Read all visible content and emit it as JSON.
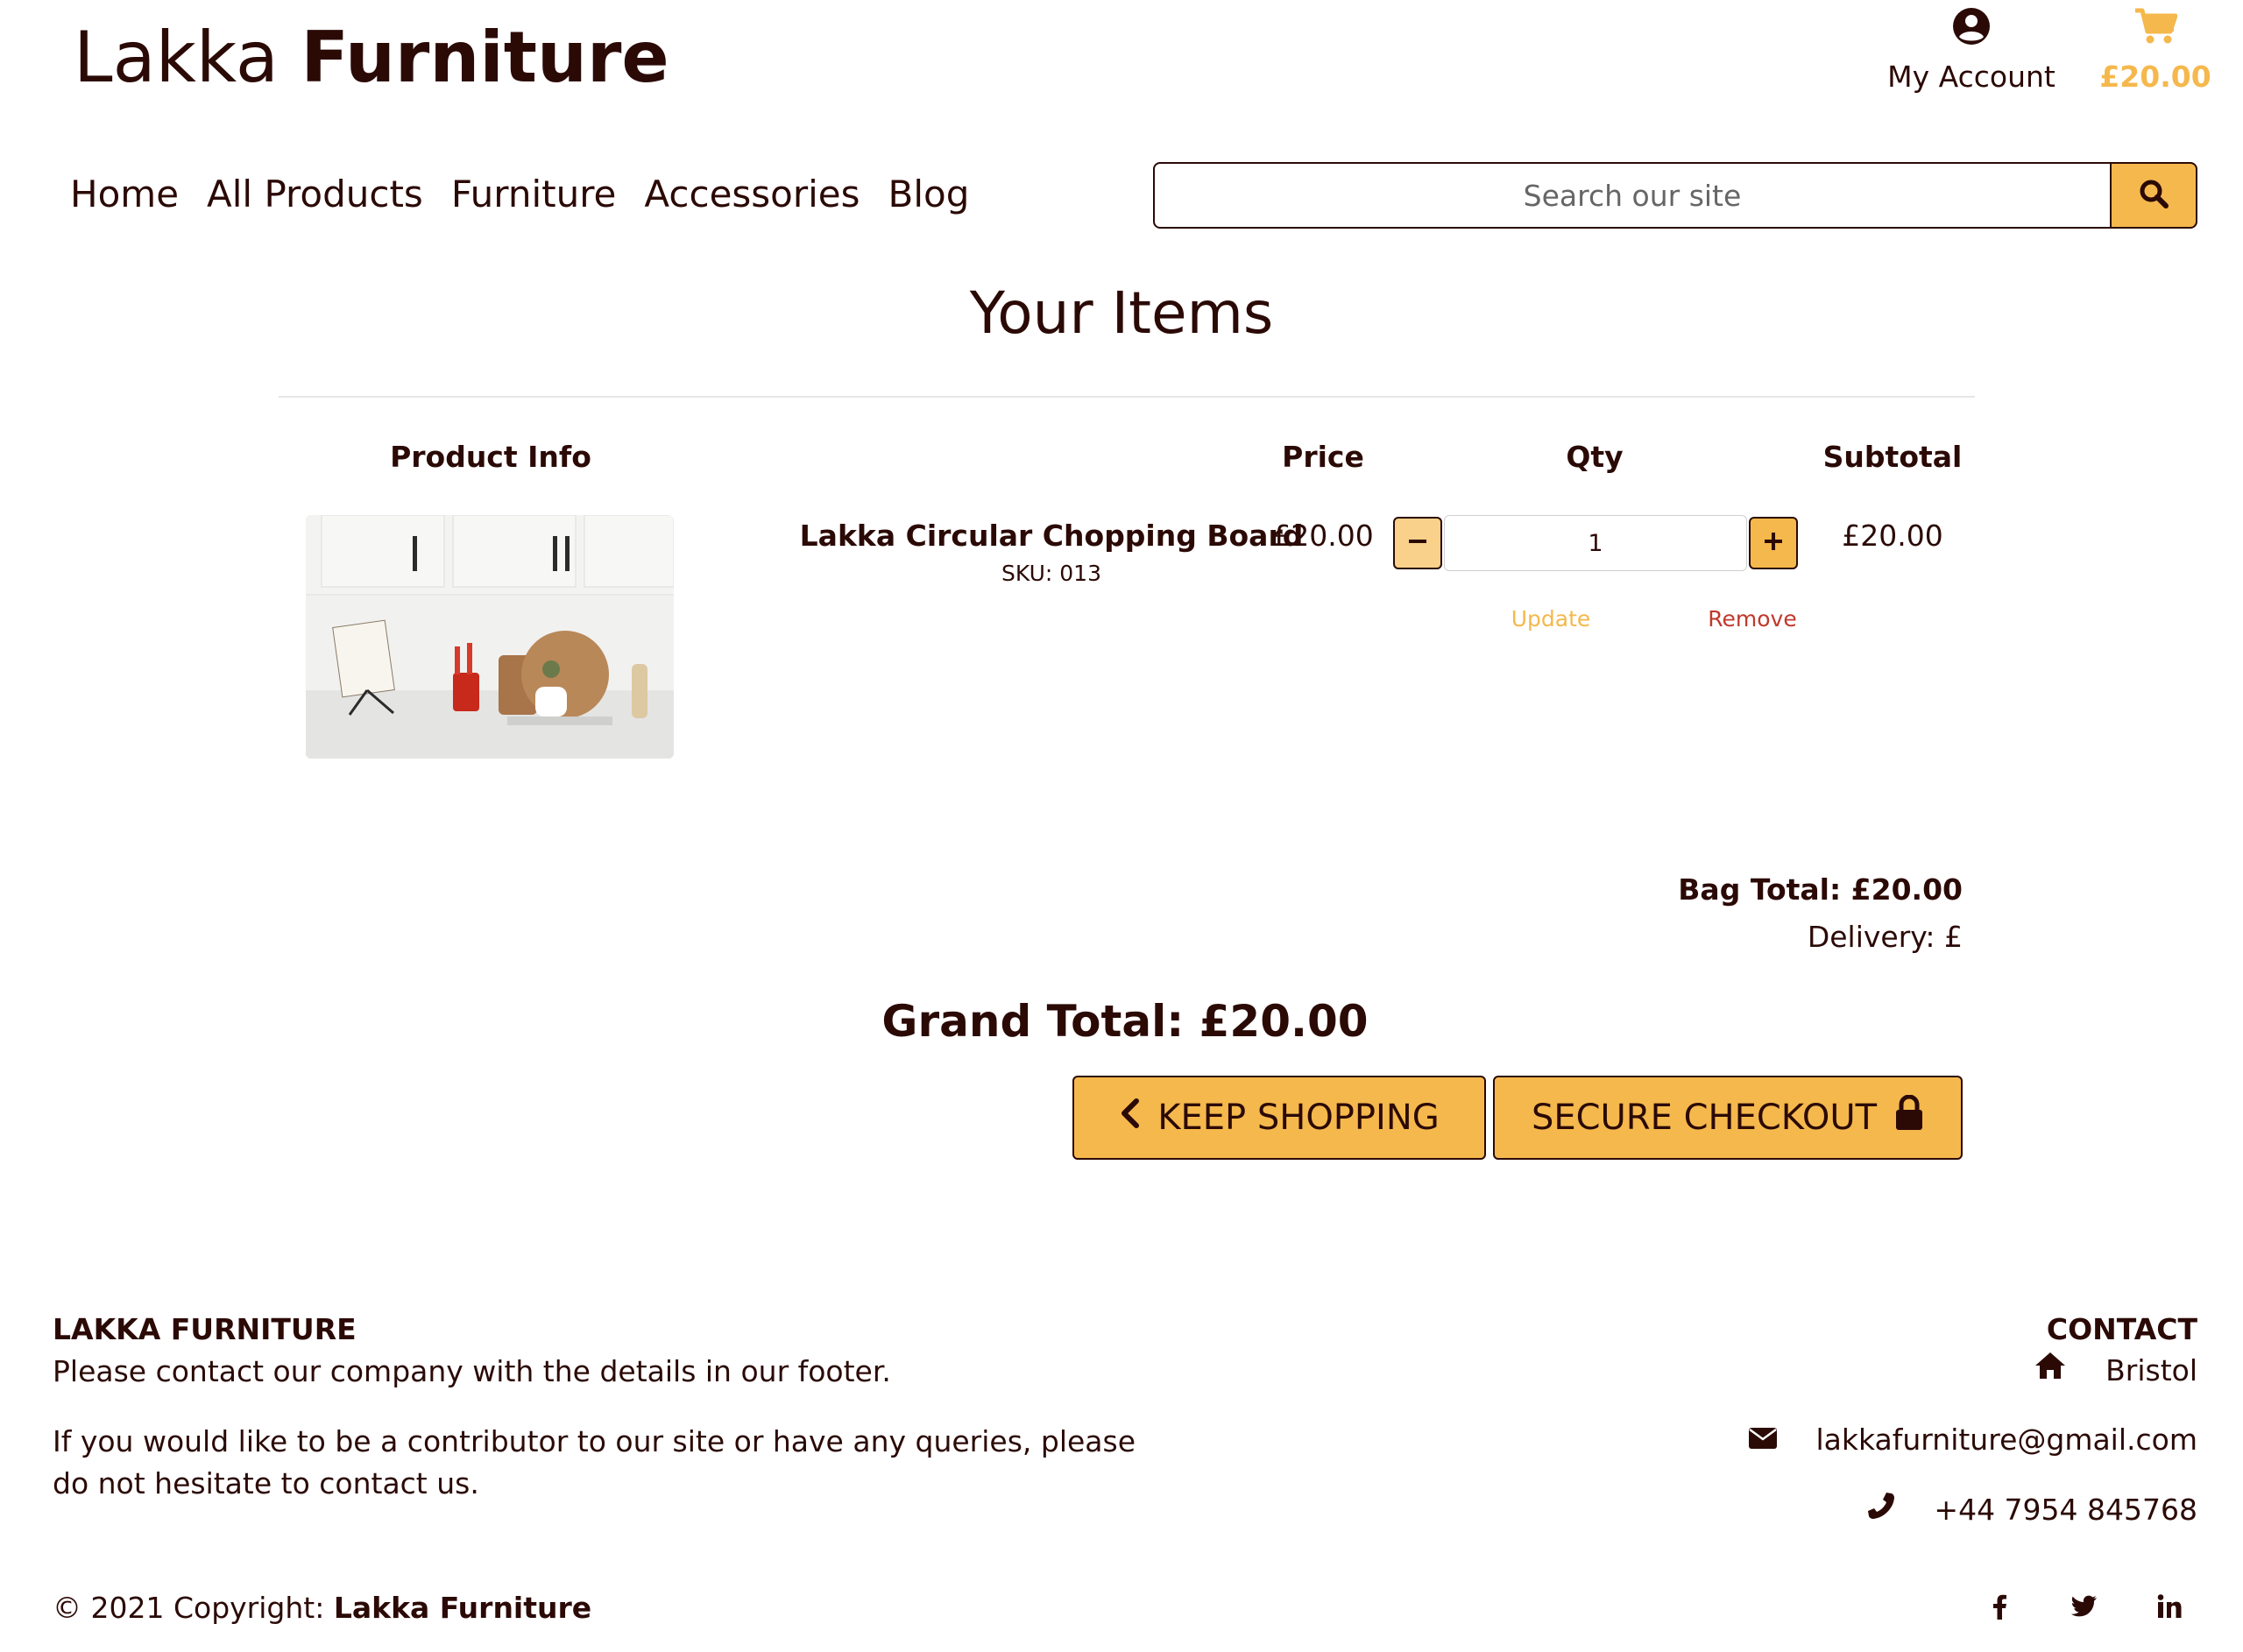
{
  "header": {
    "brand_light": "Lakka",
    "brand_bold": "Furniture",
    "account_label": "My Account",
    "cart_total": "£20.00"
  },
  "nav": {
    "items": [
      "Home",
      "All Products",
      "Furniture",
      "Accessories",
      "Blog"
    ]
  },
  "search": {
    "placeholder": "Search our site"
  },
  "bag": {
    "title": "Your Items",
    "columns": {
      "product_info": "Product Info",
      "price": "Price",
      "qty": "Qty",
      "subtotal": "Subtotal"
    },
    "items": [
      {
        "name": "Lakka Circular Chopping Board",
        "sku_label": "SKU: 013",
        "price": "£20.00",
        "quantity": "1",
        "subtotal": "£20.00",
        "update_label": "Update",
        "remove_label": "Remove"
      }
    ],
    "bag_total": "Bag Total: £20.00",
    "delivery": "Delivery: £",
    "grand_total": "Grand Total: £20.00",
    "keep_shopping_label": "KEEP SHOPPING",
    "checkout_label": "SECURE CHECKOUT"
  },
  "footer": {
    "company_heading": "LAKKA FURNITURE",
    "company_text_1": "Please contact our company with the details in our footer.",
    "company_text_2a": "If you would like to be a contributor to our site or have any queries, please",
    "company_text_2b": "do not hesitate to contact us.",
    "contact_heading": "CONTACT",
    "location": "Bristol",
    "email": "lakkafurniture@gmail.com",
    "phone": "+44 7954 845768",
    "copyright_prefix": "© 2021 Copyright:",
    "copyright_brand": "Lakka Furniture"
  },
  "colors": {
    "primary": "#2b0a06",
    "accent": "#f5b84c",
    "accent_light": "#f9d18a",
    "remove": "#c0392b"
  },
  "icons": [
    "user-circle-icon",
    "cart-icon",
    "search-icon",
    "minus-icon",
    "plus-icon",
    "chevron-left-icon",
    "lock-icon",
    "home-icon",
    "envelope-icon",
    "phone-icon",
    "facebook-icon",
    "twitter-icon",
    "linkedin-icon"
  ]
}
